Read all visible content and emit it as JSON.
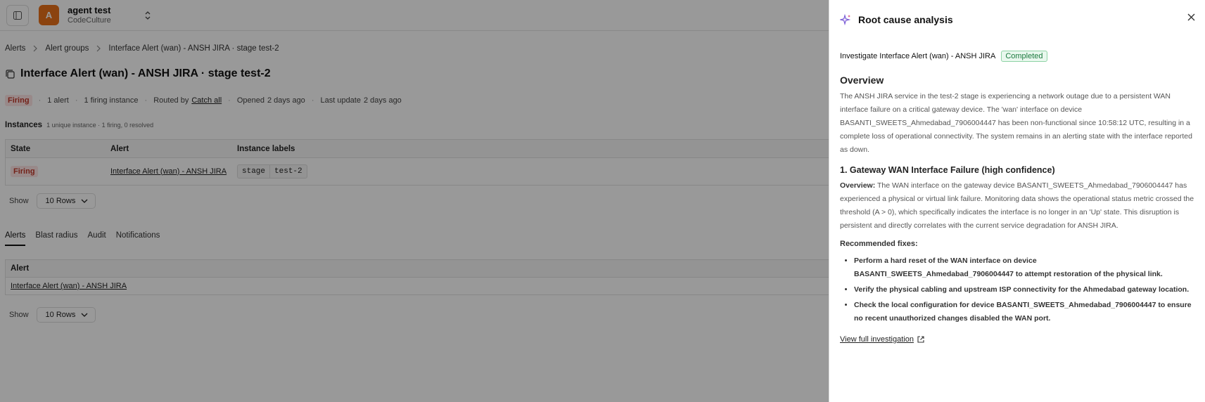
{
  "org": {
    "avatar_letter": "A",
    "name": "agent test",
    "sub": "CodeCulture",
    "avatar_color": "#e8701a"
  },
  "breadcrumb": [
    "Alerts",
    "Alert groups",
    "Interface Alert (wan) - ANSH JIRA · stage test-2"
  ],
  "page": {
    "title": "Interface Alert (wan) - ANSH JIRA · stage test-2",
    "status": "Firing",
    "alerts_count": "1 alert",
    "firing_instances": "1 firing instance",
    "routed_by_label": "Routed by",
    "routed_by_value": "Catch all",
    "opened_label": "Opened",
    "opened_value": "2 days ago",
    "last_update_label": "Last update",
    "last_update_value": "2 days ago"
  },
  "instances": {
    "title": "Instances",
    "summary": "1 unique instance · 1 firing, 0 resolved",
    "headers": {
      "state": "State",
      "alert": "Alert",
      "labels": "Instance labels"
    },
    "row": {
      "state": "Firing",
      "alert": "Interface Alert (wan) - ANSH JIRA",
      "label_key": "stage",
      "label_value": "test-2"
    },
    "show_label": "Show",
    "rows_value": "10 Rows"
  },
  "tabs": [
    "Alerts",
    "Blast radius",
    "Audit",
    "Notifications"
  ],
  "alerts_table": {
    "header": "Alert",
    "row": "Interface Alert (wan) - ANSH JIRA",
    "show_label": "Show",
    "rows_value": "10 Rows"
  },
  "panel": {
    "title": "Root cause analysis",
    "investigate": "Investigate Interface Alert (wan) - ANSH JIRA",
    "status": "Completed",
    "overview_heading": "Overview",
    "overview_text": "The ANSH JIRA service in the test-2 stage is experiencing a network outage due to a persistent WAN interface failure on a critical gateway device. The 'wan' interface on device BASANTI_SWEETS_Ahmedabad_7906004447 has been non-functional since 10:58:12 UTC, resulting in a complete loss of operational connectivity. The system remains in an alerting state with the interface reported as down.",
    "cause_heading": "1. Gateway WAN Interface Failure (high confidence)",
    "cause_label": "Overview:",
    "cause_text": "The WAN interface on the gateway device BASANTI_SWEETS_Ahmedabad_7906004447 has experienced a physical or virtual link failure. Monitoring data shows the operational status metric crossed the threshold (A > 0), which specifically indicates the interface is no longer in an 'Up' state. This disruption is persistent and directly correlates with the current service degradation for ANSH JIRA.",
    "fixes_heading": "Recommended fixes:",
    "fixes": [
      "Perform a hard reset of the WAN interface on device BASANTI_SWEETS_Ahmedabad_7906004447 to attempt restoration of the physical link.",
      "Verify the physical cabling and upstream ISP connectivity for the Ahmedabad gateway location.",
      "Check the local configuration for device BASANTI_SWEETS_Ahmedabad_7906004447 to ensure no recent unauthorized changes disabled the WAN port."
    ],
    "view_link": "View full investigation",
    "status_color": "#1b7a3e"
  }
}
